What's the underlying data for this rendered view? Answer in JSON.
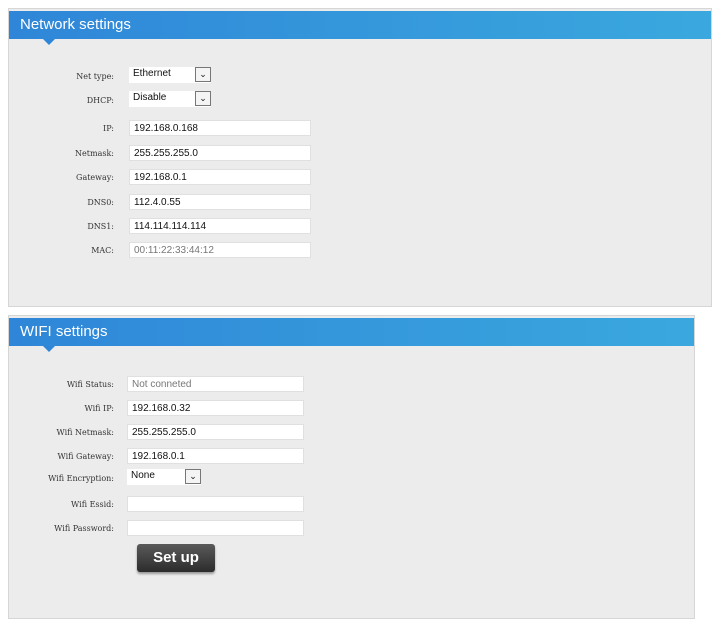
{
  "network": {
    "title": "Network settings",
    "fields": [
      {
        "label": "Net type:",
        "value": "Ethernet",
        "type": "select"
      },
      {
        "label": "DHCP:",
        "value": "Disable",
        "type": "select"
      },
      {
        "label": "IP:",
        "value": "192.168.0.168"
      },
      {
        "label": "Netmask:",
        "value": "255.255.255.0"
      },
      {
        "label": "Gateway:",
        "value": "192.168.0.1"
      },
      {
        "label": "DNS0:",
        "value": "112.4.0.55"
      },
      {
        "label": "DNS1:",
        "value": "114.114.114.114"
      },
      {
        "label": "MAC:",
        "value": "00:11:22:33:44:12"
      }
    ]
  },
  "wifi": {
    "title": "WIFI settings",
    "fields": [
      {
        "label": "Wifi Status:",
        "value": "Not conneted"
      },
      {
        "label": "Wifi IP:",
        "value": "192.168.0.32"
      },
      {
        "label": "Wifi Netmask:",
        "value": "255.255.255.0"
      },
      {
        "label": "Wifi Gateway:",
        "value": "192.168.0.1"
      },
      {
        "label": "Wifi Encryption:",
        "value": "None",
        "type": "select"
      },
      {
        "label": "Wifi Essid:",
        "value": ""
      },
      {
        "label": "Wifi Password:",
        "value": ""
      }
    ],
    "button": "Set up"
  },
  "icons": {
    "dropdown": "chevron-down-icon"
  }
}
